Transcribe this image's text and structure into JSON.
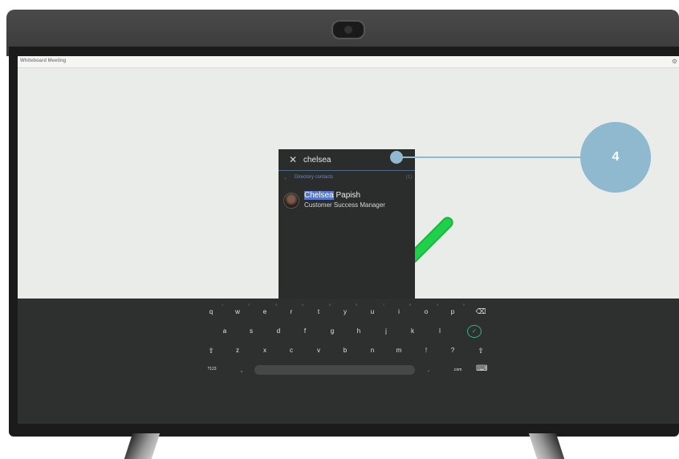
{
  "window": {
    "title": "Whiteboard Meeting"
  },
  "search": {
    "value": "chelsea"
  },
  "directory": {
    "section_label": "Directory contacts",
    "count": "(1)",
    "contacts": [
      {
        "name_highlight": "Chelsea",
        "name_rest": " Papish",
        "title": "Customer Success Manager"
      }
    ]
  },
  "keyboard": {
    "row1": [
      "q",
      "w",
      "e",
      "r",
      "t",
      "y",
      "u",
      "i",
      "o",
      "p"
    ],
    "row1_hints": [
      "1",
      "2",
      "3",
      "4",
      "5",
      "6",
      "7",
      "8",
      "9",
      "0"
    ],
    "row2": [
      "a",
      "s",
      "d",
      "f",
      "g",
      "h",
      "j",
      "k",
      "l"
    ],
    "row3": [
      "z",
      "x",
      "c",
      "v",
      "b",
      "n",
      "m",
      "!",
      "?"
    ],
    "row4": {
      "symbols": "?123",
      "comma": ",",
      "period": ".",
      "dotcom": ".com"
    }
  },
  "callout": {
    "number": "4"
  },
  "icons": {
    "close": "close-icon",
    "backspace": "backspace-icon",
    "enter": "check-circle-icon",
    "shift": "shift-icon",
    "keyboard_hide": "keyboard-icon",
    "settings": "gear-icon"
  },
  "colors": {
    "accent": "#5b8fd0",
    "callout": "#8eb9cf",
    "stroke": "#1fd14a",
    "enter": "#2bb58a"
  }
}
